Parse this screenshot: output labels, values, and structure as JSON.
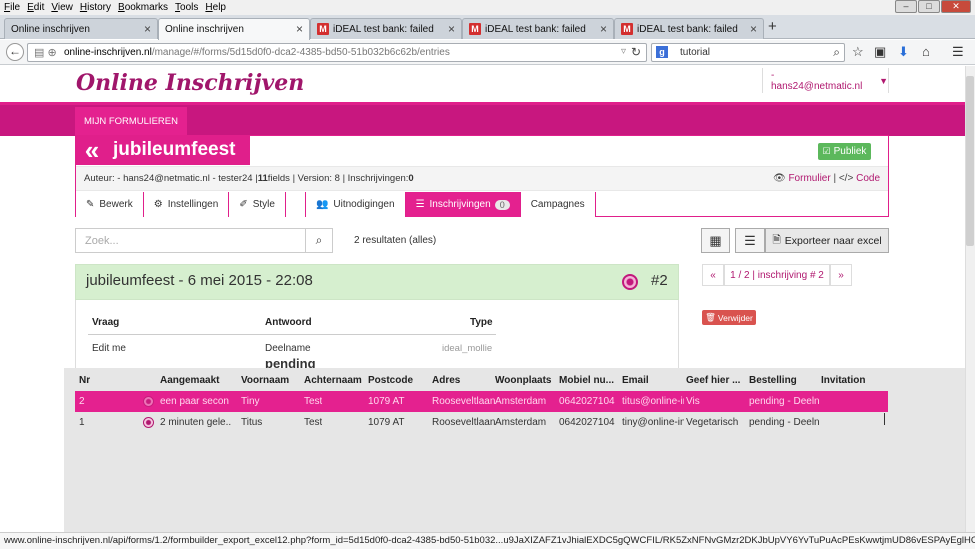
{
  "menubar": {
    "items": [
      "File",
      "Edit",
      "View",
      "History",
      "Bookmarks",
      "Tools",
      "Help"
    ]
  },
  "window_controls": {
    "minimize": "–",
    "maximize": "□",
    "close": "✕"
  },
  "tabs": [
    {
      "label": "Online inschrijven",
      "icon": "none"
    },
    {
      "label": "Online inschrijven",
      "icon": "none"
    },
    {
      "label": "iDEAL test bank: failed",
      "icon": "gmail-icon"
    },
    {
      "label": "iDEAL test bank: failed",
      "icon": "gmail-icon"
    },
    {
      "label": "iDEAL test bank: failed",
      "icon": "gmail-icon"
    }
  ],
  "newtab": "+",
  "address": {
    "host": "online-inschrijven.nl",
    "path": "/manage/#/forms/5d15d0f0-dca2-4385-bd50-51b032b6c62b/entries"
  },
  "searchbar": {
    "value": "tutorial"
  },
  "brand": "Online Inschrijven",
  "user": {
    "email": "- hans24@netmatic.nl"
  },
  "nav": {
    "mijn": "MIJN FORMULIEREN"
  },
  "form": {
    "title": "jubileumfeest",
    "publiek": "Publiek",
    "meta_prefix": "Auteur: - hans24@netmatic.nl - tester24 | ",
    "fields_count": "11",
    "meta_mid": " fields | Version: 8 | Inschrijvingen: ",
    "inschrijvingen": "0",
    "formulier_link": "Formulier",
    "code_link": "Code"
  },
  "form_tabs": [
    "Bewerk",
    "Instellingen",
    "Style",
    "",
    "Uitnodigingen",
    "Inschrijvingen",
    "Campagnes"
  ],
  "inschrijvingen_badge": "0",
  "search": {
    "placeholder": "Zoek...",
    "results": "2 resultaten (alles)"
  },
  "export_label": "Exporteer naar excel",
  "pagination": {
    "prev": "«",
    "current": "1 / 2 | inschrijving # 2",
    "next": "»"
  },
  "entry": {
    "title": "jubileumfeest - 6 mei 2015 - 22:08",
    "number": "#2",
    "headers": {
      "vraag": "Vraag",
      "antwoord": "Antwoord",
      "type": "Type"
    },
    "row": {
      "vraag": "Edit me",
      "antwoord": "Deelname",
      "type": "ideal_mollie",
      "status": "pending"
    }
  },
  "verwijder": "Verwijder",
  "grid": {
    "columns": [
      "Nr",
      "Aangemaakt",
      "Voornaam",
      "Achternaam",
      "Postcode",
      "Adres",
      "Woonplaats",
      "Mobiel nu...",
      "Email",
      "Geef hier ...",
      "Bestelling",
      "Invitation"
    ],
    "rows": [
      {
        "nr": "2",
        "aangemaakt": "een paar secon",
        "voornaam": "Tiny",
        "achternaam": "Test",
        "postcode": "1079 AT",
        "adres": "Rooseveltlaan",
        "woonplaats": "Amsterdam",
        "mobiel": "0642027104",
        "email": "titus@online-ir",
        "geef": "Vis",
        "bestelling": "pending - Deeln",
        "invitation": "",
        "selected": true
      },
      {
        "nr": "1",
        "aangemaakt": "2 minuten gele...",
        "voornaam": "Titus",
        "achternaam": "Test",
        "postcode": "1079 AT",
        "adres": "Rooseveltlaan",
        "woonplaats": "Amsterdam",
        "mobiel": "0642027104",
        "email": "tiny@online-in:",
        "geef": "Vegetarisch",
        "bestelling": "pending - Deeln",
        "invitation": "",
        "selected": false
      }
    ]
  },
  "status_url": "www.online-inschrijven.nl/api/forms/1.2/formbuilder_export_excel12.php?form_id=5d15d0f0-dca2-4385-bd50-51b032...u9JaXIZAFZ1vJhialEXDC5gQWCFIL/RK5ZxNFNvGMzr2DKJbUpVY6YvTuPuAcPEsKwwtjmUD86vESPAyEglHCZb9YksqOkaKjEkYnOBvg==",
  "colors": {
    "brand": "#a0166b",
    "accent": "#e4218f",
    "green": "#5cb85c",
    "danger": "#d9534f"
  }
}
